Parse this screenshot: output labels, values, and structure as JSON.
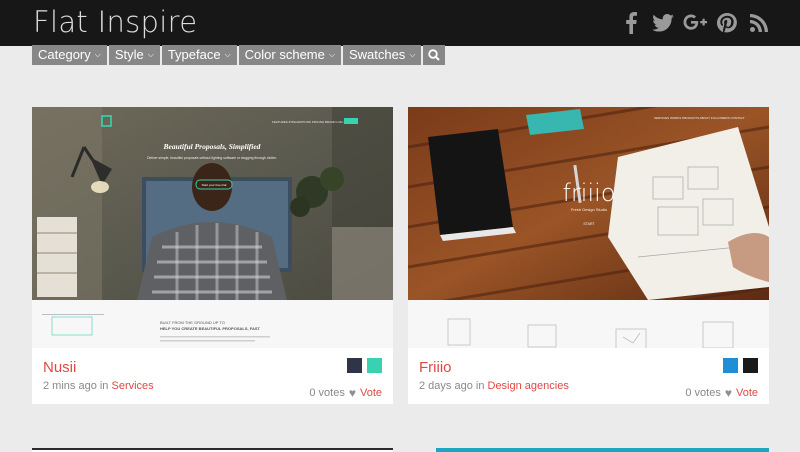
{
  "site": {
    "title": "Flat Inspire"
  },
  "social": [
    "facebook-icon",
    "twitter-icon",
    "google-plus-icon",
    "pinterest-icon",
    "rss-icon"
  ],
  "filters": [
    {
      "label": "Category"
    },
    {
      "label": "Style"
    },
    {
      "label": "Typeface"
    },
    {
      "label": "Color scheme"
    },
    {
      "label": "Swatches"
    }
  ],
  "cards": [
    {
      "name": "Nusii",
      "time": "2 mins ago in",
      "category": "Services",
      "votes": "0 votes",
      "vote_label": "Vote",
      "swatches": [
        "#303448",
        "#3ad1b1"
      ],
      "shot": {
        "headline": "Beautiful Proposals, Simplified",
        "sub": "Deliver simple, beautiful proposals without fighting software or slogging through clutter.",
        "cta": "Start your free trial",
        "built": "BUILT FROM THE GROUND UP TO",
        "help": "HELP YOU CREATE BEAUTIFUL PROPOSALS, FAST",
        "nav": [
          "FEATURES",
          "INTEGRATIONS",
          "PRICING",
          "BRAND",
          "LOG IN"
        ]
      }
    },
    {
      "name": "Friiio",
      "time": "2 days ago in",
      "category": "Design agencies",
      "votes": "0 votes",
      "vote_label": "Vote",
      "swatches": [
        "#1e8fd6",
        "#1a1a1a"
      ],
      "shot": {
        "logo": "friiio",
        "tag": "Fresh Design Studio",
        "cta": "START",
        "nav": [
          "SERVICES",
          "WORKS",
          "PRODUCTS",
          "ABOUT",
          "FOLLOWERS",
          "CONTACT"
        ]
      }
    }
  ]
}
